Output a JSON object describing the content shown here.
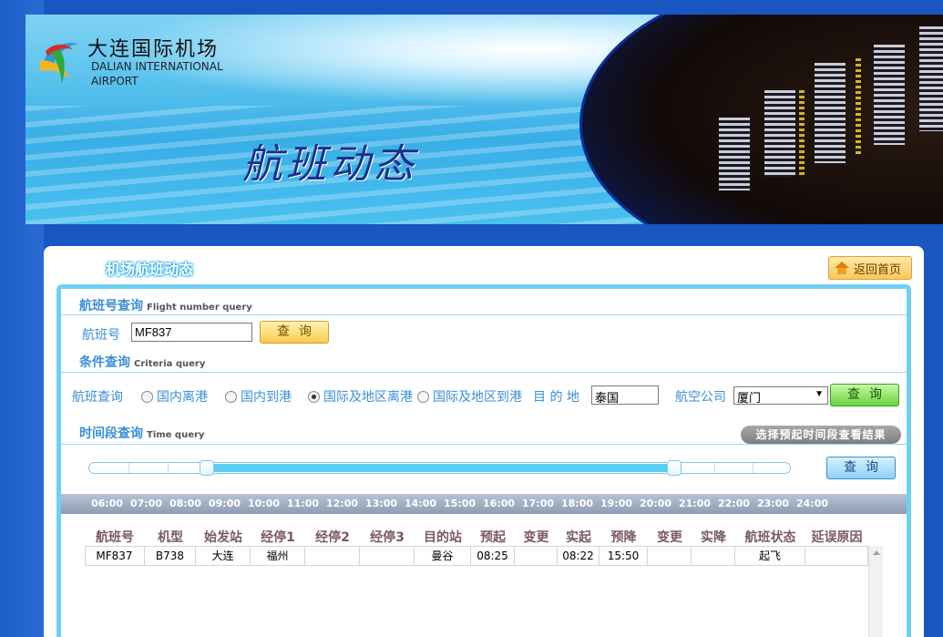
{
  "banner": {
    "logo_cn": "大连国际机场",
    "logo_en_line1": "DALIAN INTERNATIONAL",
    "logo_en_line2": "AIRPORT",
    "title": "航班动态"
  },
  "panel": {
    "title": "机场航班动态",
    "home_button": "返回首页"
  },
  "flight_number_query": {
    "heading": "航班号查询",
    "heading_en": "Flight number query",
    "label": "航班号",
    "value": "MF837",
    "button": "查询"
  },
  "criteria_query": {
    "heading": "条件查询",
    "heading_en": "Criteria query",
    "label": "航班查询",
    "options": [
      {
        "label": "国内离港",
        "selected": false
      },
      {
        "label": "国内到港",
        "selected": false
      },
      {
        "label": "国际及地区离港",
        "selected": true
      },
      {
        "label": "国际及地区到港",
        "selected": false
      }
    ],
    "destination_label": "目 的 地",
    "destination_value": "泰国",
    "airline_label": "航空公司",
    "airline_value": "厦门",
    "button": "查询"
  },
  "time_query": {
    "heading": "时间段查询",
    "heading_en": "Time query",
    "hint": "选择预起时间段查看结果",
    "button": "查询",
    "range_start_fraction": 0.17,
    "range_end_fraction": 0.836,
    "hours": [
      "06:00",
      "07:00",
      "08:00",
      "09:00",
      "10:00",
      "11:00",
      "12:00",
      "13:00",
      "14:00",
      "15:00",
      "16:00",
      "17:00",
      "18:00",
      "19:00",
      "20:00",
      "21:00",
      "22:00",
      "23:00",
      "24:00"
    ]
  },
  "results": {
    "columns": [
      "航班号",
      "机型",
      "始发站",
      "经停1",
      "经停2",
      "经停3",
      "目的站",
      "预起",
      "变更",
      "实起",
      "预降",
      "变更",
      "实降",
      "航班状态",
      "延误原因"
    ],
    "rows": [
      [
        "MF837",
        "B738",
        "大连",
        "福州",
        "",
        "",
        "曼谷",
        "08:25",
        "",
        "08:22",
        "15:50",
        "",
        "",
        "起飞",
        ""
      ]
    ]
  },
  "colors": {
    "page_bg": "#1a56c2",
    "accent_blue": "#3a8fd8",
    "frame_blue": "#6fd0f5",
    "slider_fill": "#5ccff3"
  }
}
